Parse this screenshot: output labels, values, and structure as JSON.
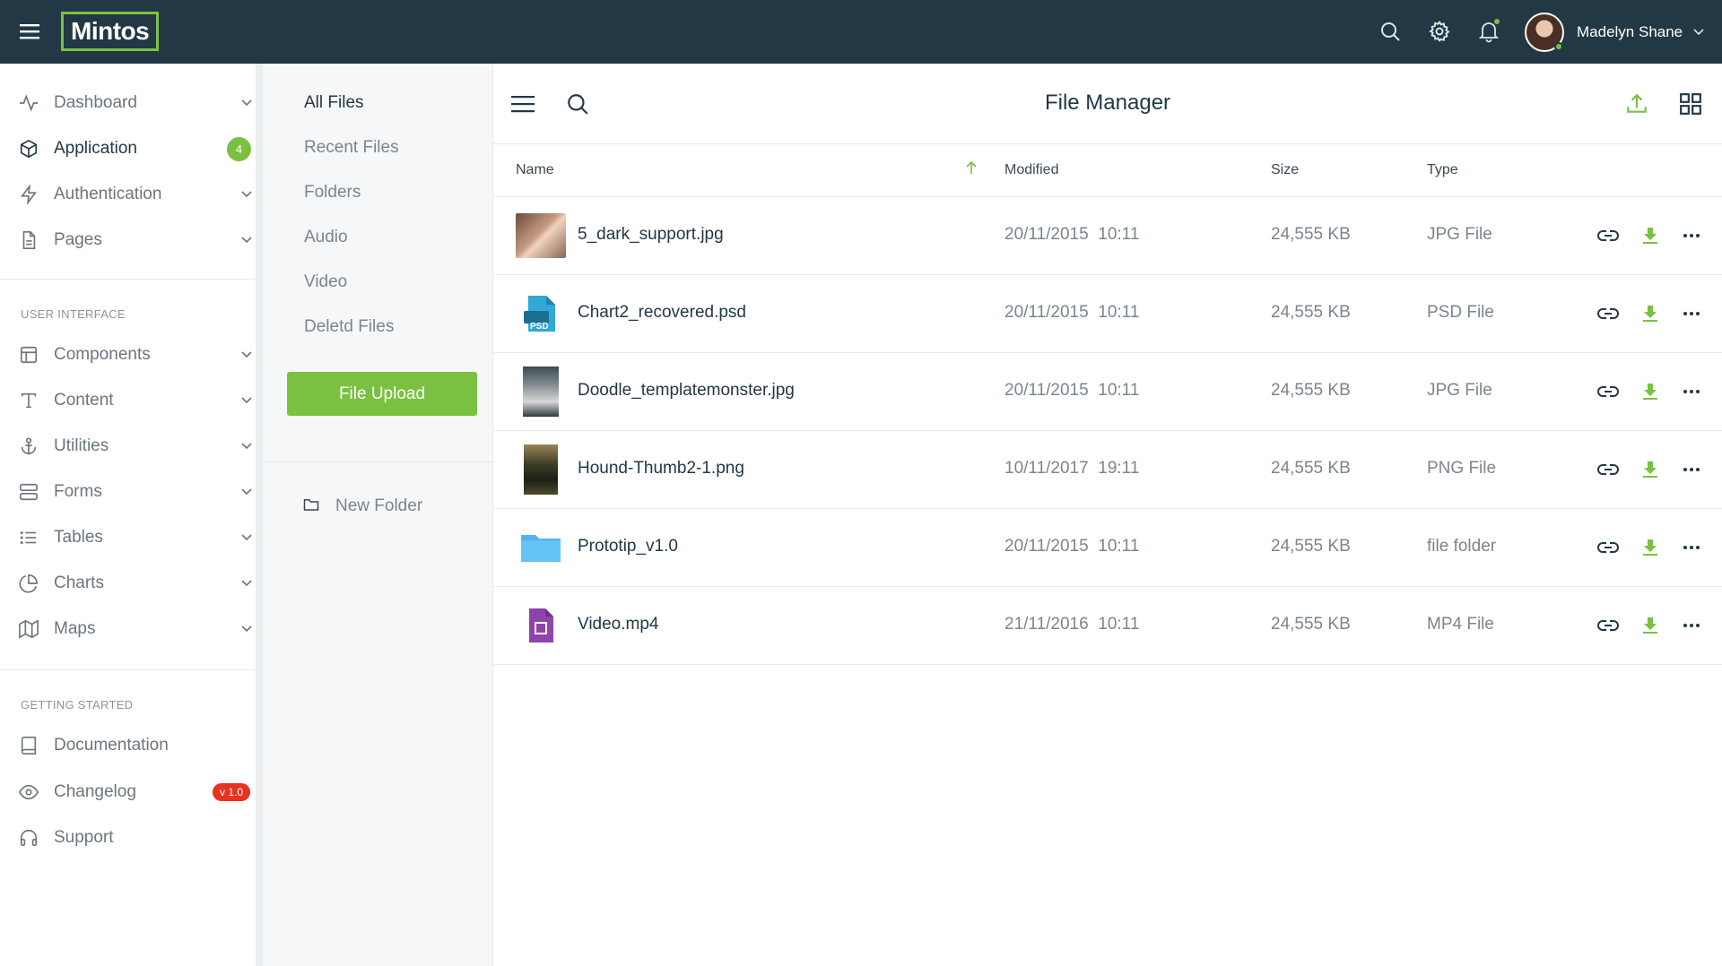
{
  "app": {
    "logo": "Mintos"
  },
  "user": {
    "name": "Madelyn Shane"
  },
  "sidebar": {
    "items": [
      {
        "label": "Dashboard"
      },
      {
        "label": "Application",
        "badge": "4"
      },
      {
        "label": "Authentication"
      },
      {
        "label": "Pages"
      }
    ],
    "section_ui": "USER INTERFACE",
    "ui_items": [
      {
        "label": "Components"
      },
      {
        "label": "Content"
      },
      {
        "label": "Utilities"
      },
      {
        "label": "Forms"
      },
      {
        "label": "Tables"
      },
      {
        "label": "Charts"
      },
      {
        "label": "Maps"
      }
    ],
    "section_start": "GETTING STARTED",
    "start_items": [
      {
        "label": "Documentation"
      },
      {
        "label": "Changelog",
        "badge": "v 1.0"
      },
      {
        "label": "Support"
      }
    ]
  },
  "filters": {
    "items": [
      "All Files",
      "Recent Files",
      "Folders",
      "Audio",
      "Video",
      "Deletd Files"
    ],
    "upload_label": "File Upload",
    "new_folder_label": "New Folder"
  },
  "main": {
    "title": "File Manager",
    "columns": {
      "name": "Name",
      "modified": "Modified",
      "size": "Size",
      "type": "Type"
    },
    "rows": [
      {
        "name": "5_dark_support.jpg",
        "date": "20/11/2015",
        "time": "10:11",
        "size": "24,555 KB",
        "type": "JPG File",
        "icon": "photo-thumb"
      },
      {
        "name": "Chart2_recovered.psd",
        "date": "20/11/2015",
        "time": "10:11",
        "size": "24,555 KB",
        "type": "PSD File",
        "icon": "psd-file-icon",
        "icon_text": "PSD"
      },
      {
        "name": "Doodle_templatemonster.jpg",
        "date": "20/11/2015",
        "time": "10:11",
        "size": "24,555 KB",
        "type": "JPG File",
        "icon": "photo-thumb"
      },
      {
        "name": "Hound-Thumb2-1.png",
        "date": "10/11/2017",
        "time": "19:11",
        "size": "24,555 KB",
        "type": "PNG File",
        "icon": "photo-thumb"
      },
      {
        "name": "Prototip_v1.0",
        "date": "20/11/2015",
        "time": "10:11",
        "size": "24,555 KB",
        "type": "file folder",
        "icon": "folder-icon"
      },
      {
        "name": "Video.mp4",
        "date": "21/11/2016",
        "time": "10:11",
        "size": "24,555 KB",
        "type": "MP4 File",
        "icon": "video-file-icon"
      }
    ]
  },
  "colors": {
    "topbar": "#223845",
    "accent": "#7ac142",
    "badge_red": "#e8321f",
    "folder": "#64c3f5",
    "video": "#8e44ad",
    "psd": "#31a8d6"
  }
}
